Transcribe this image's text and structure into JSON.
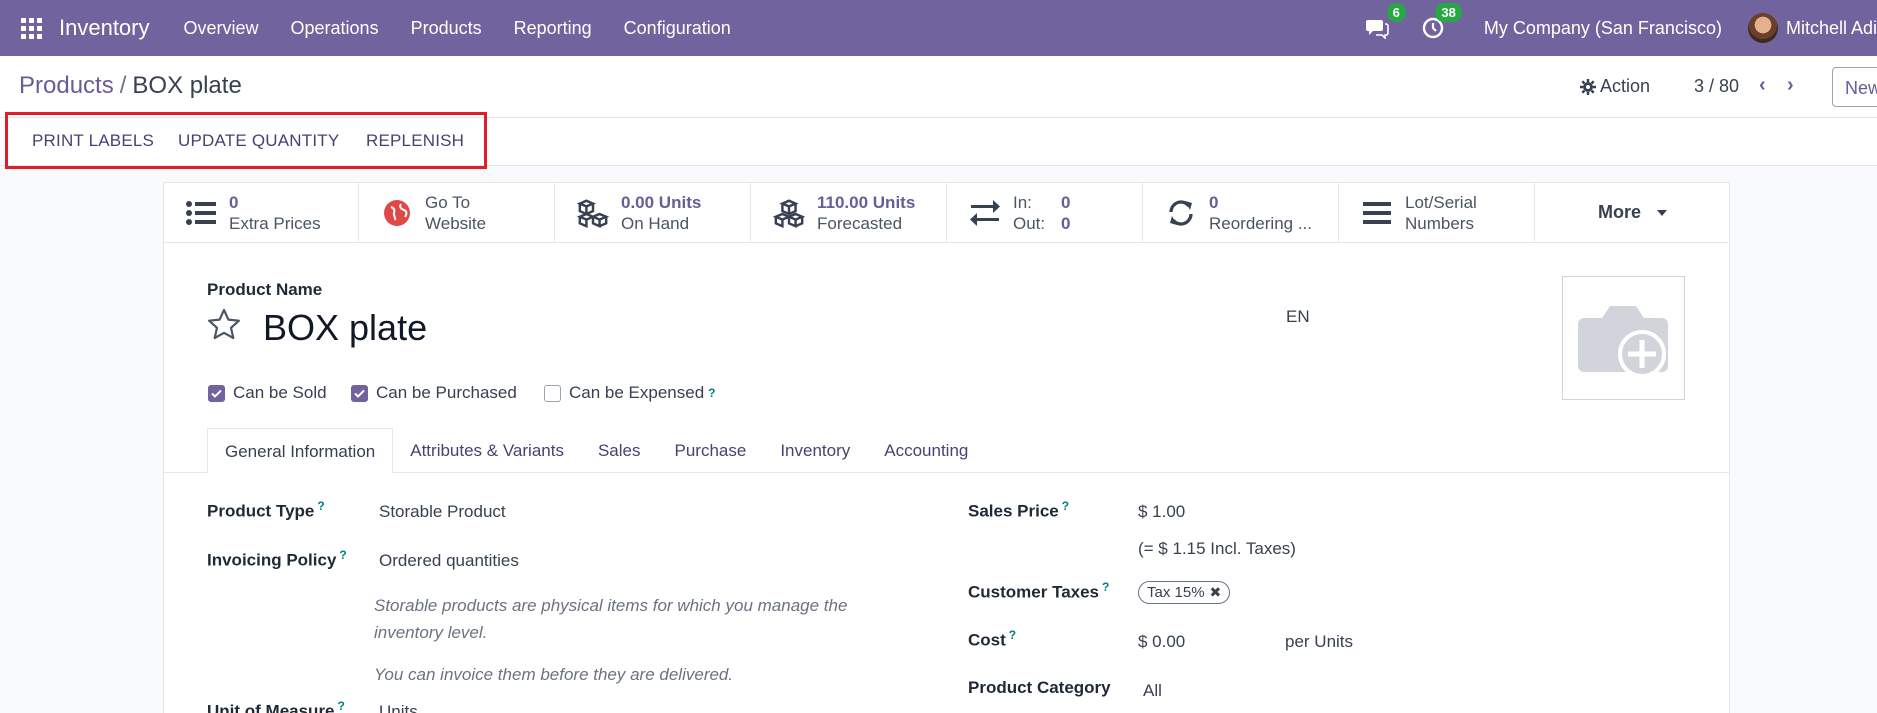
{
  "navbar": {
    "app_name": "Inventory",
    "menu": [
      "Overview",
      "Operations",
      "Products",
      "Reporting",
      "Configuration"
    ],
    "messages_count": "6",
    "activities_count": "38",
    "company": "My Company (San Francisco)",
    "user": "Mitchell Adi",
    "bg_color": "#71639e"
  },
  "control": {
    "breadcrumb_parent": "Products",
    "breadcrumb_sep": "/",
    "breadcrumb_current": "BOX plate",
    "action_label": "Action",
    "pager": "3 / 80",
    "new_label": "New"
  },
  "header_buttons": {
    "print_labels": "PRINT LABELS",
    "update_quantity": "UPDATE QUANTITY",
    "replenish": "REPLENISH",
    "highlight_color": "#e11d2a"
  },
  "smart_buttons": {
    "extra_prices_value": "0",
    "extra_prices_label": "Extra Prices",
    "website_line1": "Go To",
    "website_line2": "Website",
    "on_hand_value": "0.00 Units",
    "on_hand_label": "On Hand",
    "forecast_value": "110.00 Units",
    "forecast_label": "Forecasted",
    "in_label": "In:",
    "in_value": "0",
    "out_label": "Out:",
    "out_value": "0",
    "reordering_value": "0",
    "reordering_label": "Reordering ...",
    "lot_line1": "Lot/Serial",
    "lot_line2": "Numbers",
    "more_label": "More"
  },
  "form": {
    "product_name_label": "Product Name",
    "product_name": "BOX plate",
    "lang": "EN",
    "can_be_sold": "Can be Sold",
    "can_be_purchased": "Can be Purchased",
    "can_be_expensed": "Can be Expensed",
    "tabs": [
      "General Information",
      "Attributes & Variants",
      "Sales",
      "Purchase",
      "Inventory",
      "Accounting"
    ],
    "product_type_label": "Product Type",
    "product_type": "Storable Product",
    "invoicing_policy_label": "Invoicing Policy",
    "invoicing_policy": "Ordered quantities",
    "help_1": "Storable products are physical items for which you manage the inventory level.",
    "help_2": "You can invoice them before they are delivered.",
    "uom_label": "Unit of Measure",
    "uom_value": "Units",
    "sales_price_label": "Sales Price",
    "sales_price": "$ 1.00",
    "incl_taxes": "(= $ 1.15 Incl. Taxes)",
    "customer_taxes_label": "Customer Taxes",
    "tax_tag": "Tax 15%",
    "cost_label": "Cost",
    "cost_value": "$ 0.00",
    "per_units": "per Units",
    "category_label": "Product Category",
    "category_value": "All",
    "help_marker": "?"
  }
}
